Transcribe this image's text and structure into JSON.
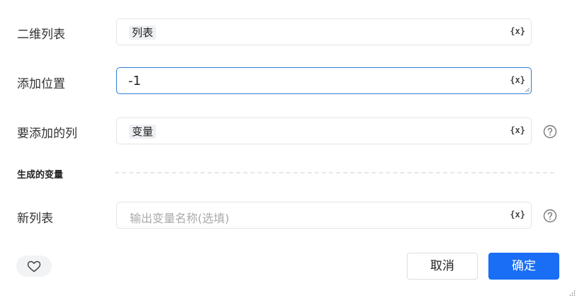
{
  "form": {
    "rows": [
      {
        "label": "二维列表",
        "chip": "列表"
      },
      {
        "label": "添加位置",
        "value": "-1"
      },
      {
        "label": "要添加的列",
        "chip": "变量"
      }
    ],
    "var_icon": "{x}",
    "section_title": "生成的变量",
    "output_row": {
      "label": "新列表",
      "placeholder": "输出变量名称(选填)"
    }
  },
  "footer": {
    "cancel_label": "取消",
    "ok_label": "确定"
  },
  "colors": {
    "primary": "#1a6ef5",
    "focus_border": "#2f7bd6"
  },
  "icons": [
    "variable-icon",
    "help-icon",
    "heart-icon",
    "resize-grip-icon"
  ]
}
